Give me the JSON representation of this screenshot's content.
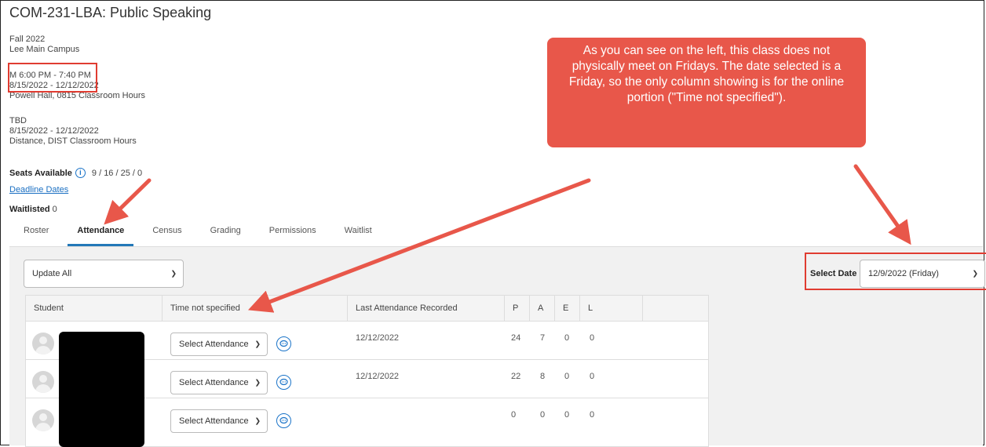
{
  "course": {
    "title": "COM-231-LBA: Public Speaking",
    "term": "Fall 2022",
    "campus": "Lee Main Campus",
    "meeting1": {
      "time": "M 6:00 PM - 7:40 PM",
      "dates": "8/15/2022 - 12/12/2022",
      "location": "Powell Hall, 0815 Classroom Hours"
    },
    "meeting2": {
      "time": "TBD",
      "dates": "8/15/2022 - 12/12/2022",
      "location": "Distance, DIST Classroom Hours"
    },
    "seats_label": "Seats Available",
    "seats_value": "9 / 16 / 25 / 0",
    "deadline_link": "Deadline Dates",
    "waitlisted_label": "Waitlisted",
    "waitlisted_value": "0"
  },
  "tabs": [
    "Roster",
    "Attendance",
    "Census",
    "Grading",
    "Permissions",
    "Waitlist"
  ],
  "active_tab": "Attendance",
  "update_all": "Update All",
  "select_date": {
    "label": "Select Date",
    "value": "12/9/2022 (Friday)"
  },
  "table": {
    "headers": [
      "Student",
      "Time not specified",
      "Last Attendance Recorded",
      "P",
      "A",
      "E",
      "L"
    ],
    "rows": [
      {
        "attendance_select": "Select Attendance",
        "last_recorded": "12/12/2022",
        "p": "24",
        "a": "7",
        "e": "0",
        "l": "0"
      },
      {
        "attendance_select": "Select Attendance",
        "last_recorded": "12/12/2022",
        "p": "22",
        "a": "8",
        "e": "0",
        "l": "0"
      },
      {
        "attendance_select": "Select Attendance",
        "last_recorded": "",
        "p": "0",
        "a": "0",
        "e": "0",
        "l": "0"
      }
    ]
  },
  "callout": "As you can see on the left, this class does not physically meet on Fridays. The date selected is a Friday, so the only column showing is for the online portion (\"Time not specified\").",
  "colors": {
    "annotation": "#e03c31",
    "callout": "#e8574a",
    "tab_underline": "#2378b8",
    "link": "#1a6fc2"
  },
  "icons": [
    "info-icon",
    "chevron-down-icon",
    "comment-icon",
    "avatar-icon"
  ]
}
